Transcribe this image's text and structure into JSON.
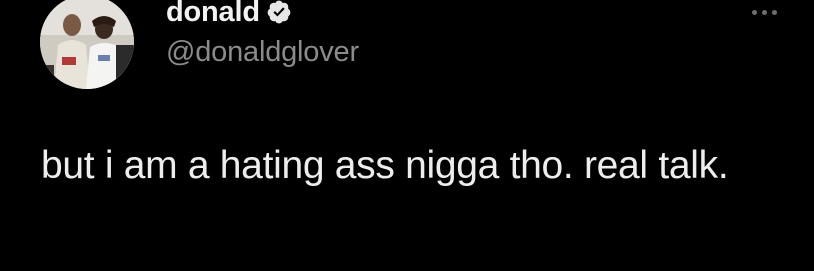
{
  "tweet": {
    "author": {
      "display_name": "donald",
      "handle": "@donaldglover",
      "verified": true,
      "avatar_icon": "profile-photo"
    },
    "text": "but i am a hating ass nigga tho. real talk.",
    "more_icon": "ellipsis-icon"
  },
  "colors": {
    "background": "#000000",
    "name": "#f2f2f2",
    "handle": "#8b8b8b",
    "text": "#ededed",
    "more": "#6e6e6e"
  }
}
